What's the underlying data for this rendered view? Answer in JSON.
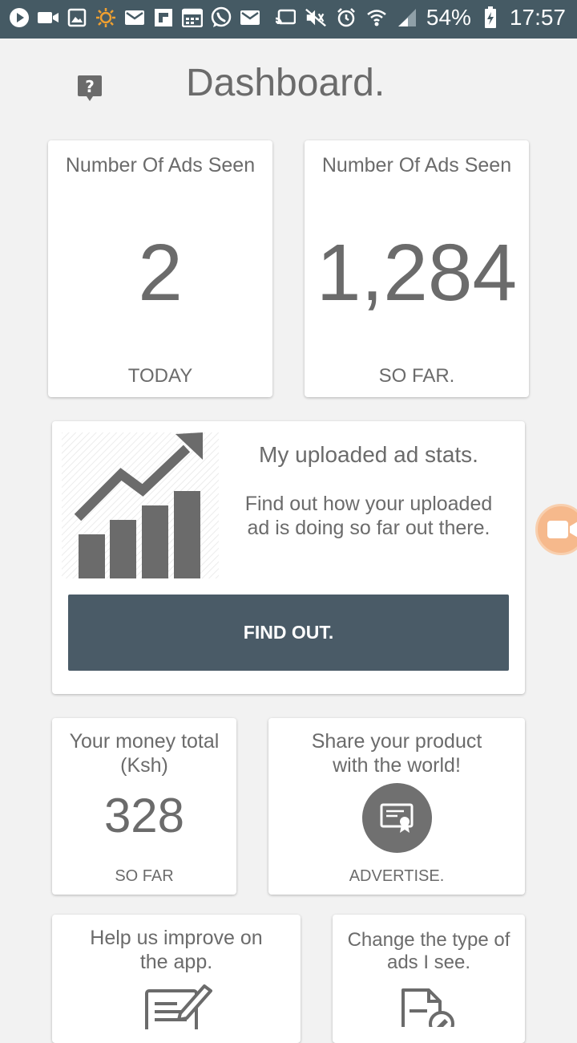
{
  "status_bar": {
    "battery_percent": "54%",
    "time": "17:57",
    "background_color": "#455a64",
    "left_icons": [
      "play-icon",
      "video-camera-icon",
      "image-icon",
      "brightness-icon",
      "mail-icon",
      "flipboard-icon",
      "calendar-icon",
      "whatsapp-icon",
      "mail-icon"
    ],
    "right_icons": [
      "cast-icon",
      "mute-icon",
      "alarm-icon",
      "wifi-icon",
      "signal-icon",
      "battery-icon"
    ]
  },
  "header": {
    "title": "Dashboard.",
    "help_icon": "help-bubble-icon"
  },
  "ads_today": {
    "title": "Number Of Ads Seen",
    "value": "2",
    "footer": "TODAY"
  },
  "ads_total": {
    "title": "Number Of Ads Seen",
    "value": "1,284",
    "footer": "SO FAR."
  },
  "uploaded_stats": {
    "title": "My uploaded ad stats.",
    "description": "Find out how your uploaded ad is doing so far out there.",
    "button_label": "FIND OUT.",
    "button_color": "#4a5b67",
    "icon": "bar-chart-trend-icon"
  },
  "money": {
    "title": "Your money total (Ksh)",
    "value": "328",
    "footer": "SO FAR"
  },
  "advertise": {
    "title": "Share your product with the world!",
    "label": "ADVERTISE.",
    "icon": "certificate-icon"
  },
  "feedback": {
    "title": "Help us improve on the app.",
    "icon": "edit-document-icon"
  },
  "ad_preferences": {
    "title": "Change the type of ads I see.",
    "icon": "document-settings-icon"
  },
  "floating_button": {
    "icon": "video-camera-icon",
    "color": "#f6b98c"
  }
}
